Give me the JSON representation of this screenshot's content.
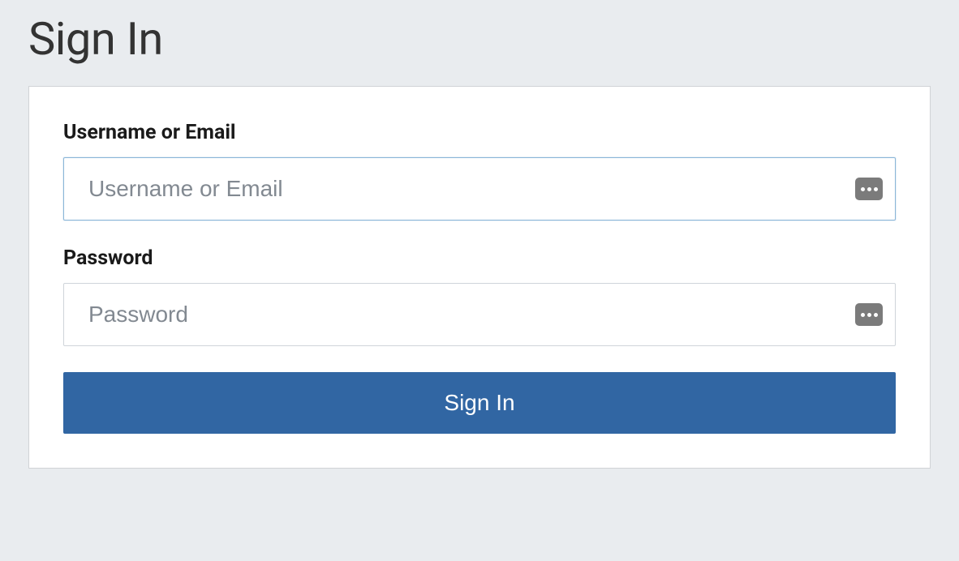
{
  "page": {
    "title": "Sign In"
  },
  "form": {
    "username": {
      "label": "Username or Email",
      "placeholder": "Username or Email",
      "value": ""
    },
    "password": {
      "label": "Password",
      "placeholder": "Password",
      "value": ""
    },
    "submit_label": "Sign In"
  },
  "colors": {
    "background": "#e9ecef",
    "card_bg": "#ffffff",
    "button_bg": "#3166a3",
    "button_text": "#ffffff",
    "text_primary": "#333333",
    "placeholder": "#828991",
    "border": "#cfd4da",
    "focus_border": "#8bb6d8"
  }
}
